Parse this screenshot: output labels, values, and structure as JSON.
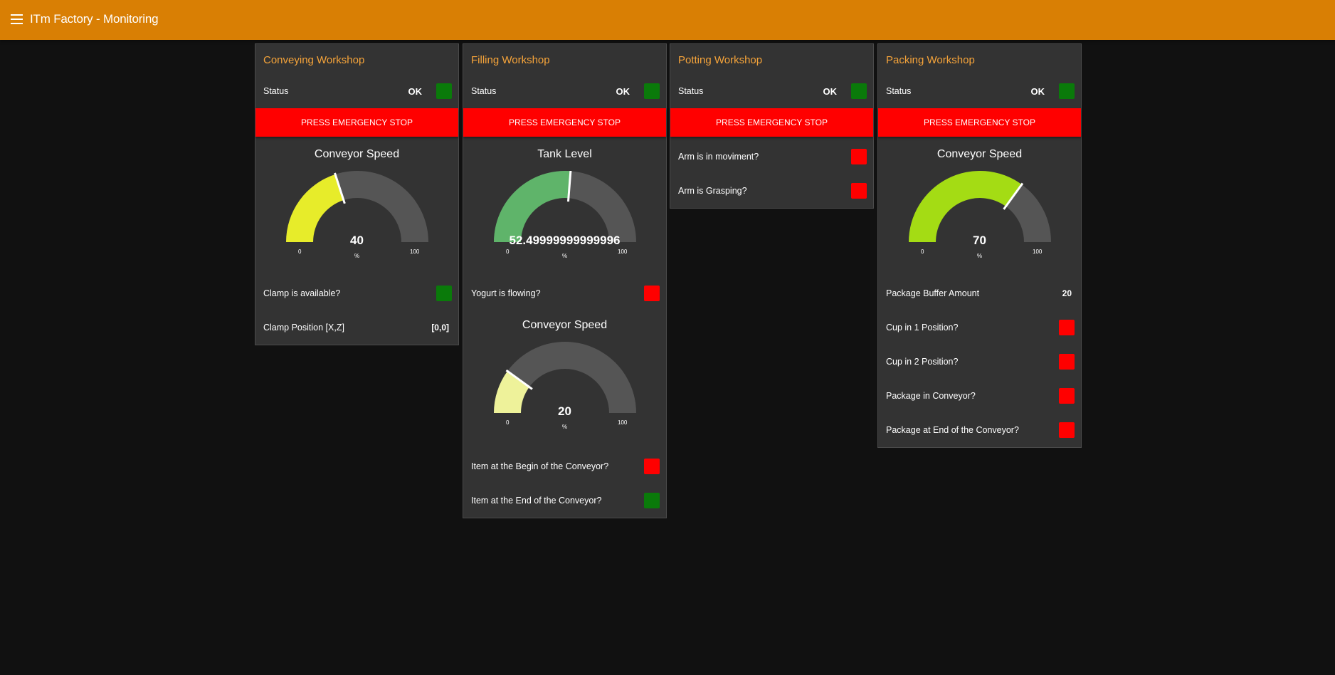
{
  "app": {
    "title": "ITm Factory - Monitoring",
    "menu_icon": "hamburger-menu-icon"
  },
  "colors": {
    "header": "#d97f04",
    "background": "#111111",
    "card": "#333333",
    "card_title": "#f6a43a",
    "led_green": "#0a7a0a",
    "led_red": "#ff0000",
    "gauge_track": "#555555"
  },
  "conveying": {
    "title": "Conveying Workshop",
    "status_label": "Status",
    "status_value": "OK",
    "status_led": "green",
    "estop_label": "PRESS EMERGENCY STOP",
    "gauge": {
      "title": "Conveyor Speed",
      "value": 40,
      "display": "40",
      "unit": "%",
      "min": 0,
      "max": 100,
      "min_label": "0",
      "max_label": "100",
      "color": "#e7ec2a"
    },
    "clamp_available_label": "Clamp is available?",
    "clamp_available_led": "green",
    "clamp_position_label": "Clamp Position [X,Z]",
    "clamp_position_value": "[0,0]"
  },
  "filling": {
    "title": "Filling Workshop",
    "status_label": "Status",
    "status_value": "OK",
    "status_led": "green",
    "estop_label": "PRESS EMERGENCY STOP",
    "tank_gauge": {
      "title": "Tank Level",
      "value": 52.49999999999996,
      "display": "52.49999999999996",
      "unit": "%",
      "min": 0,
      "max": 100,
      "min_label": "0",
      "max_label": "100",
      "color": "#5fb46a"
    },
    "yogurt_label": "Yogurt is flowing?",
    "yogurt_led": "red",
    "speed_gauge": {
      "title": "Conveyor Speed",
      "value": 20,
      "display": "20",
      "unit": "%",
      "min": 0,
      "max": 100,
      "min_label": "0",
      "max_label": "100",
      "color": "#eef29a"
    },
    "item_begin_label": "Item at the Begin of the Conveyor?",
    "item_begin_led": "red",
    "item_end_label": "Item at the End of the Conveyor?",
    "item_end_led": "green"
  },
  "potting": {
    "title": "Potting Workshop",
    "status_label": "Status",
    "status_value": "OK",
    "status_led": "green",
    "estop_label": "PRESS EMERGENCY STOP",
    "arm_moving_label": "Arm is in moviment?",
    "arm_moving_led": "red",
    "arm_grasping_label": "Arm is Grasping?",
    "arm_grasping_led": "red"
  },
  "packing": {
    "title": "Packing Workshop",
    "status_label": "Status",
    "status_value": "OK",
    "status_led": "green",
    "estop_label": "PRESS EMERGENCY STOP",
    "gauge": {
      "title": "Conveyor Speed",
      "value": 70,
      "display": "70",
      "unit": "%",
      "min": 0,
      "max": 100,
      "min_label": "0",
      "max_label": "100",
      "color": "#a4dc14"
    },
    "buffer_label": "Package Buffer Amount",
    "buffer_value": "20",
    "cup1_label": "Cup in 1 Position?",
    "cup1_led": "red",
    "cup2_label": "Cup in 2 Position?",
    "cup2_led": "red",
    "pkg_conveyor_label": "Package in Conveyor?",
    "pkg_conveyor_led": "red",
    "pkg_end_label": "Package at End of the Conveyor?",
    "pkg_end_led": "red"
  }
}
